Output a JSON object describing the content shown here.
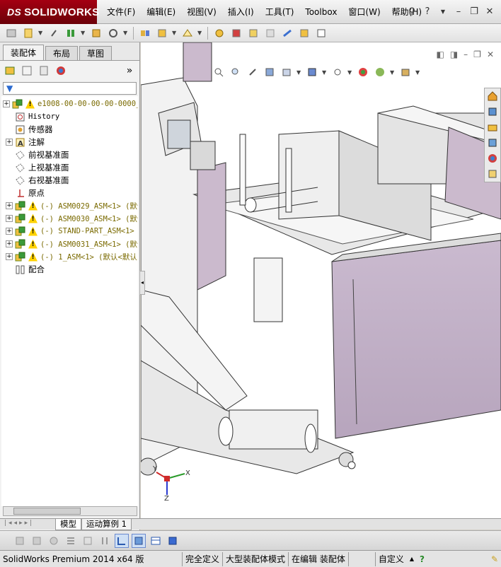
{
  "app": {
    "logo": "SOLIDWORKS",
    "logo_prefix": "DS"
  },
  "menu": [
    "文件(F)",
    "编辑(E)",
    "视图(V)",
    "插入(I)",
    "工具(T)",
    "Toolbox",
    "窗口(W)",
    "帮助(H)"
  ],
  "left_panel": {
    "tabs": [
      "装配体",
      "布局",
      "草图"
    ],
    "active_tab": "装配体",
    "tree": [
      {
        "label": "e1008-00-00-00-00-0000_",
        "expand": "+",
        "type": "assembly",
        "warn": true
      },
      {
        "label": "History",
        "type": "history"
      },
      {
        "label": "传感器",
        "type": "sensor"
      },
      {
        "label": "注解",
        "expand": "+",
        "type": "annotation"
      },
      {
        "label": "前视基准面",
        "type": "plane"
      },
      {
        "label": "上视基准面",
        "type": "plane"
      },
      {
        "label": "右视基准面",
        "type": "plane"
      },
      {
        "label": "原点",
        "type": "origin"
      },
      {
        "label": "(-) ASM0029_ASM<1> (默认",
        "expand": "+",
        "type": "assembly",
        "warn": true
      },
      {
        "label": "(-) ASM0030_ASM<1> (默认",
        "expand": "+",
        "type": "assembly",
        "warn": true
      },
      {
        "label": "(-) STAND-PART_ASM<1>",
        "expand": "+",
        "type": "assembly",
        "warn": true
      },
      {
        "label": "(-) ASM0031_ASM<1> (默认",
        "expand": "+",
        "type": "assembly",
        "warn": true
      },
      {
        "label": "(-) 1_ASM<1> (默认<默认",
        "expand": "+",
        "type": "assembly",
        "warn": true
      },
      {
        "label": "配合",
        "type": "mates"
      }
    ]
  },
  "bottom_tabs": [
    "模型",
    "运动算例 1"
  ],
  "status_bar": {
    "app_info": "SolidWorks Premium 2014 x64 版",
    "definition": "完全定义",
    "mode": "大型装配体模式",
    "editing": "在编辑 装配体",
    "units": "自定义"
  },
  "colors": {
    "logo_bg": "#a40012",
    "accent_purple": "#c9b8cc",
    "tree_warn": "#7a6a00"
  },
  "axes": {
    "x": "X",
    "y": "Y",
    "z": "Z"
  }
}
